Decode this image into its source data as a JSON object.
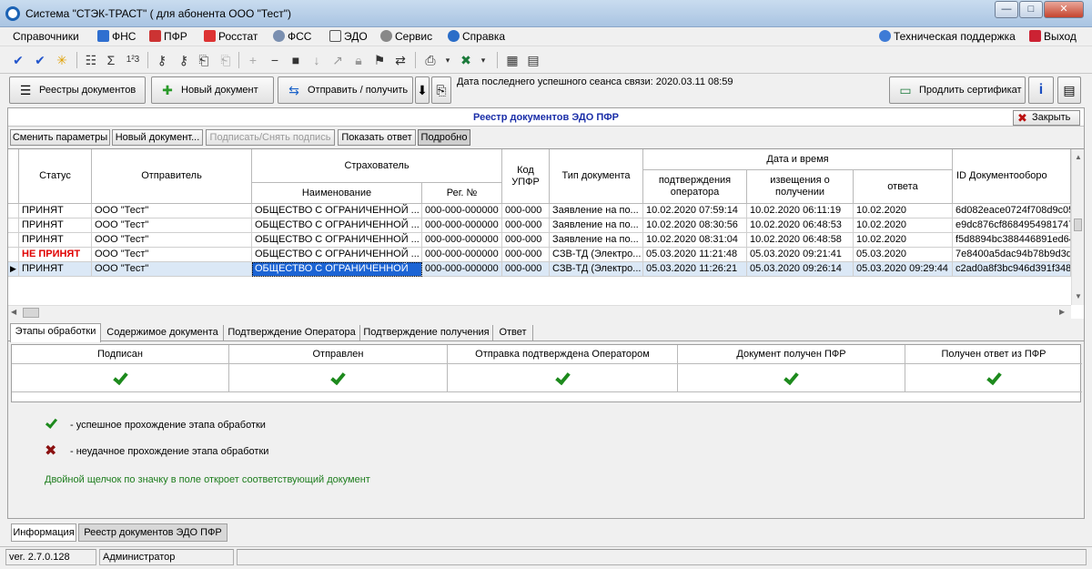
{
  "window": {
    "title": "Система \"СТЭК-ТРАСТ\" ( для абонента ООО \"Тест\")"
  },
  "menu": {
    "items": [
      "Справочники",
      "ФНС",
      "ПФР",
      "Росстат",
      "ФСС",
      "ЭДО",
      "Сервис",
      "Справка"
    ],
    "support": "Техническая поддержка",
    "exit": "Выход"
  },
  "toolbar": {
    "registries": "Реестры документов",
    "new_doc": "Новый документ",
    "send_receive": "Отправить / получить",
    "last_session": "Дата последнего успешного сеанса связи: 2020.03.11 08:59",
    "renew_cert": "Продлить сертификат"
  },
  "registry": {
    "title": "Реестр документов ЭДО ПФР",
    "close": "Закрыть",
    "buttons": {
      "change_params": "Сменить параметры",
      "new_doc": "Новый документ...",
      "sign": "Подписать/Снять подпись",
      "show_answer": "Показать ответ",
      "details": "Подробно"
    },
    "headers": {
      "status": "Статус",
      "sender": "Отправитель",
      "insurer": "Страхователь",
      "name": "Наименование",
      "reg": "Рег. №",
      "upfr": "Код УПФР",
      "doctype": "Тип документа",
      "datetime": "Дата и время",
      "operator_confirm": "подтверждения оператора",
      "receipt_notice": "извещения о получении",
      "answer": "ответа",
      "flow_id": "ID Документооборо"
    },
    "rows": [
      {
        "status": "ПРИНЯТ",
        "sender": "ООО \"Тест\"",
        "name": "ОБЩЕСТВО С ОГРАНИЧЕННОЙ ...",
        "reg": "000-000-000000",
        "upfr": "000-000",
        "doctype": "Заявление на по...",
        "confirm": "10.02.2020 07:59:14",
        "notice": "10.02.2020 06:11:19",
        "answer": "10.02.2020",
        "id": "6d082eace0724f708d9c05"
      },
      {
        "status": "ПРИНЯТ",
        "sender": "ООО \"Тест\"",
        "name": "ОБЩЕСТВО С ОГРАНИЧЕННОЙ ...",
        "reg": "000-000-000000",
        "upfr": "000-000",
        "doctype": "Заявление на по...",
        "confirm": "10.02.2020 08:30:56",
        "notice": "10.02.2020 06:48:53",
        "answer": "10.02.2020",
        "id": "e9dc876cf8684954981747"
      },
      {
        "status": "ПРИНЯТ",
        "sender": "ООО \"Тест\"",
        "name": "ОБЩЕСТВО С ОГРАНИЧЕННОЙ ...",
        "reg": "000-000-000000",
        "upfr": "000-000",
        "doctype": "Заявление на по...",
        "confirm": "10.02.2020 08:31:04",
        "notice": "10.02.2020 06:48:58",
        "answer": "10.02.2020",
        "id": "f5d8894bc388446891ed64"
      },
      {
        "status": "НЕ ПРИНЯТ",
        "sender": "ООО \"Тест\"",
        "name": "ОБЩЕСТВО С ОГРАНИЧЕННОЙ ...",
        "reg": "000-000-000000",
        "upfr": "000-000",
        "doctype": "СЗВ-ТД (Электро...",
        "confirm": "05.03.2020 11:21:48",
        "notice": "05.03.2020 09:21:41",
        "answer": "05.03.2020",
        "id": "7e8400a5dac94b78b9d3d"
      },
      {
        "status": "ПРИНЯТ",
        "sender": "ООО \"Тест\"",
        "name": "ОБЩЕСТВО С ОГРАНИЧЕННОЙ",
        "reg": "000-000-000000",
        "upfr": "000-000",
        "doctype": "СЗВ-ТД (Электро...",
        "confirm": "05.03.2020 11:26:21",
        "notice": "05.03.2020 09:26:14",
        "answer": "05.03.2020 09:29:44",
        "id": "c2ad0a8f3bc946d391f348"
      }
    ]
  },
  "tabs": [
    "Этапы обработки",
    "Содержимое документа",
    "Подтверждение Оператора",
    "Подтверждение получения",
    "Ответ"
  ],
  "stages": [
    "Подписан",
    "Отправлен",
    "Отправка подтверждена Оператором",
    "Документ получен ПФР",
    "Получен ответ из ПФР"
  ],
  "legend": {
    "success": "- успешное прохождение этапа обработки",
    "fail": "- неудачное прохождение этапа обработки",
    "hint": "Двойной щелчок по значку в поле откроет соответствующий документ"
  },
  "bottom_tabs": [
    "Информация",
    "Реестр документов ЭДО ПФР"
  ],
  "statusbar": {
    "version": "ver. 2.7.0.128",
    "user": "Администратор"
  }
}
